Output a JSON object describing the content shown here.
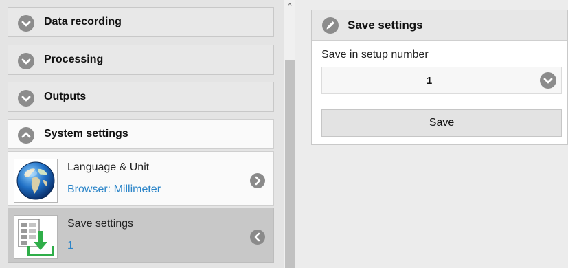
{
  "sidebar": {
    "sections": [
      {
        "label": "Data recording",
        "icon": "chevron-down-icon"
      },
      {
        "label": "Processing",
        "icon": "chevron-down-icon"
      },
      {
        "label": "Outputs",
        "icon": "chevron-down-icon"
      },
      {
        "label": "System settings",
        "icon": "chevron-up-icon"
      }
    ],
    "items": [
      {
        "title": "Language & Unit",
        "subtitle": "Browser: Millimeter",
        "icon": "globe-icon",
        "nav_icon": "chevron-right-icon"
      },
      {
        "title": "Save settings",
        "subtitle": "1",
        "icon": "save-settings-icon",
        "nav_icon": "chevron-left-icon",
        "selected": true
      }
    ]
  },
  "panel": {
    "title": "Save settings",
    "title_icon": "pencil-icon",
    "setup_label": "Save in setup number",
    "setup_value": "1",
    "save_label": "Save"
  },
  "scrollbar": {
    "up_arrow": "^"
  },
  "colors": {
    "link": "#2a84c8",
    "icon_circle": "#8c8c8c",
    "selected_item": "#c8c8c8",
    "save_icon_green": "#2fae49"
  }
}
